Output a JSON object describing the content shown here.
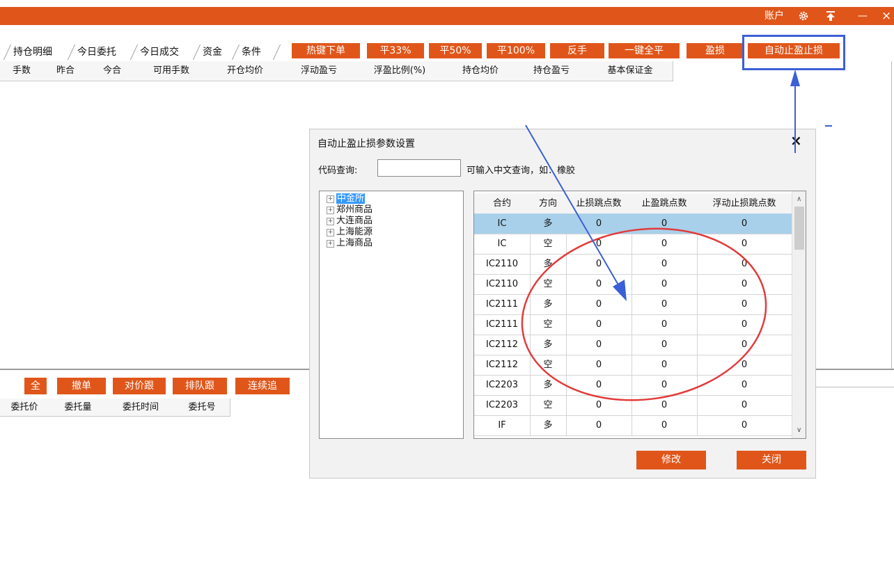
{
  "window": {
    "account_label": "账户",
    "settings_icon": "gear-icon",
    "pin_icon": "pin-top-icon",
    "minimize_symbol": "—",
    "close_symbol": "×"
  },
  "tabs": [
    "持仓明细",
    "今日委托",
    "今日成交",
    "资金",
    "条件"
  ],
  "toolbar": [
    "热键下单",
    "平33%",
    "平50%",
    "平100%",
    "反手",
    "一键全平",
    "盈损",
    "自动止盈止损"
  ],
  "position_columns": [
    "手数",
    "昨合",
    "今合",
    "可用手数",
    "开仓均价",
    "浮动盈亏",
    "浮盈比例(%)",
    "持仓均价",
    "持仓盈亏",
    "基本保证金"
  ],
  "order_buttons": [
    "全",
    "撤单",
    "对价跟",
    "排队跟",
    "连续追"
  ],
  "order_columns": [
    "委托价",
    "委托量",
    "委托时间",
    "委托号"
  ],
  "dialog": {
    "title": "自动止盈止损参数设置",
    "close_symbol": "×",
    "search_label": "代码查询:",
    "search_value": "",
    "search_hint": "可输入中文查询，如：橡胶",
    "tree": [
      "中金所",
      "郑州商品",
      "大连商品",
      "上海能源",
      "上海商品"
    ],
    "grid_columns": [
      "合约",
      "方向",
      "止损跳点数",
      "止盈跳点数",
      "浮动止损跳点数"
    ],
    "grid_rows": [
      [
        "IC",
        "多",
        "0",
        "0",
        "0"
      ],
      [
        "IC",
        "空",
        "0",
        "0",
        "0"
      ],
      [
        "IC2110",
        "多",
        "0",
        "0",
        "0"
      ],
      [
        "IC2110",
        "空",
        "0",
        "0",
        "0"
      ],
      [
        "IC2111",
        "多",
        "0",
        "0",
        "0"
      ],
      [
        "IC2111",
        "空",
        "0",
        "0",
        "0"
      ],
      [
        "IC2112",
        "多",
        "0",
        "0",
        "0"
      ],
      [
        "IC2112",
        "空",
        "0",
        "0",
        "0"
      ],
      [
        "IC2203",
        "多",
        "0",
        "0",
        "0"
      ],
      [
        "IC2203",
        "空",
        "0",
        "0",
        "0"
      ],
      [
        "IF",
        "多",
        "0",
        "0",
        "0"
      ]
    ],
    "modify_label": "修改",
    "close_label": "关闭"
  },
  "colors": {
    "accent": "#e0561a",
    "selected_row": "#a9d0ea",
    "annotation_blue": "#3b5fd6",
    "annotation_red": "#e23b3b"
  }
}
